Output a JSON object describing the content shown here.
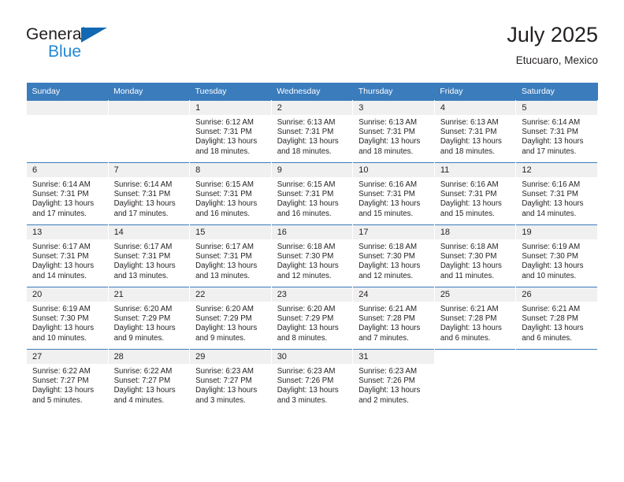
{
  "brand": {
    "name_top": "General",
    "name_bottom": "Blue",
    "triangle_color": "#1268b3",
    "blue_color": "#2389d4"
  },
  "header": {
    "title": "July 2025",
    "subtitle": "Etucuaro, Mexico"
  },
  "theme": {
    "header_bg": "#3b7cbd",
    "header_text": "#ffffff",
    "daynum_bg": "#f0f0f0",
    "daynum_bg_shaded": "#e8e8e8",
    "text": "#231f20"
  },
  "calendar": {
    "weekday_headers": [
      "Sunday",
      "Monday",
      "Tuesday",
      "Wednesday",
      "Thursday",
      "Friday",
      "Saturday"
    ],
    "labels": {
      "sunrise": "Sunrise:",
      "sunset": "Sunset:",
      "daylight": "Daylight:"
    },
    "weeks": [
      [
        {
          "day": "",
          "empty": true
        },
        {
          "day": "",
          "empty": true
        },
        {
          "day": "1",
          "sunrise": "Sunrise: 6:12 AM",
          "sunset": "Sunset: 7:31 PM",
          "daylight1": "Daylight: 13 hours",
          "daylight2": "and 18 minutes."
        },
        {
          "day": "2",
          "sunrise": "Sunrise: 6:13 AM",
          "sunset": "Sunset: 7:31 PM",
          "daylight1": "Daylight: 13 hours",
          "daylight2": "and 18 minutes."
        },
        {
          "day": "3",
          "sunrise": "Sunrise: 6:13 AM",
          "sunset": "Sunset: 7:31 PM",
          "daylight1": "Daylight: 13 hours",
          "daylight2": "and 18 minutes."
        },
        {
          "day": "4",
          "sunrise": "Sunrise: 6:13 AM",
          "sunset": "Sunset: 7:31 PM",
          "daylight1": "Daylight: 13 hours",
          "daylight2": "and 18 minutes."
        },
        {
          "day": "5",
          "sunrise": "Sunrise: 6:14 AM",
          "sunset": "Sunset: 7:31 PM",
          "daylight1": "Daylight: 13 hours",
          "daylight2": "and 17 minutes."
        }
      ],
      [
        {
          "day": "6",
          "sunrise": "Sunrise: 6:14 AM",
          "sunset": "Sunset: 7:31 PM",
          "daylight1": "Daylight: 13 hours",
          "daylight2": "and 17 minutes."
        },
        {
          "day": "7",
          "sunrise": "Sunrise: 6:14 AM",
          "sunset": "Sunset: 7:31 PM",
          "daylight1": "Daylight: 13 hours",
          "daylight2": "and 17 minutes."
        },
        {
          "day": "8",
          "sunrise": "Sunrise: 6:15 AM",
          "sunset": "Sunset: 7:31 PM",
          "daylight1": "Daylight: 13 hours",
          "daylight2": "and 16 minutes."
        },
        {
          "day": "9",
          "sunrise": "Sunrise: 6:15 AM",
          "sunset": "Sunset: 7:31 PM",
          "daylight1": "Daylight: 13 hours",
          "daylight2": "and 16 minutes."
        },
        {
          "day": "10",
          "sunrise": "Sunrise: 6:16 AM",
          "sunset": "Sunset: 7:31 PM",
          "daylight1": "Daylight: 13 hours",
          "daylight2": "and 15 minutes."
        },
        {
          "day": "11",
          "sunrise": "Sunrise: 6:16 AM",
          "sunset": "Sunset: 7:31 PM",
          "daylight1": "Daylight: 13 hours",
          "daylight2": "and 15 minutes."
        },
        {
          "day": "12",
          "sunrise": "Sunrise: 6:16 AM",
          "sunset": "Sunset: 7:31 PM",
          "daylight1": "Daylight: 13 hours",
          "daylight2": "and 14 minutes."
        }
      ],
      [
        {
          "day": "13",
          "sunrise": "Sunrise: 6:17 AM",
          "sunset": "Sunset: 7:31 PM",
          "daylight1": "Daylight: 13 hours",
          "daylight2": "and 14 minutes."
        },
        {
          "day": "14",
          "sunrise": "Sunrise: 6:17 AM",
          "sunset": "Sunset: 7:31 PM",
          "daylight1": "Daylight: 13 hours",
          "daylight2": "and 13 minutes."
        },
        {
          "day": "15",
          "sunrise": "Sunrise: 6:17 AM",
          "sunset": "Sunset: 7:31 PM",
          "daylight1": "Daylight: 13 hours",
          "daylight2": "and 13 minutes."
        },
        {
          "day": "16",
          "sunrise": "Sunrise: 6:18 AM",
          "sunset": "Sunset: 7:30 PM",
          "daylight1": "Daylight: 13 hours",
          "daylight2": "and 12 minutes."
        },
        {
          "day": "17",
          "sunrise": "Sunrise: 6:18 AM",
          "sunset": "Sunset: 7:30 PM",
          "daylight1": "Daylight: 13 hours",
          "daylight2": "and 12 minutes."
        },
        {
          "day": "18",
          "sunrise": "Sunrise: 6:18 AM",
          "sunset": "Sunset: 7:30 PM",
          "daylight1": "Daylight: 13 hours",
          "daylight2": "and 11 minutes."
        },
        {
          "day": "19",
          "sunrise": "Sunrise: 6:19 AM",
          "sunset": "Sunset: 7:30 PM",
          "daylight1": "Daylight: 13 hours",
          "daylight2": "and 10 minutes."
        }
      ],
      [
        {
          "day": "20",
          "sunrise": "Sunrise: 6:19 AM",
          "sunset": "Sunset: 7:30 PM",
          "daylight1": "Daylight: 13 hours",
          "daylight2": "and 10 minutes."
        },
        {
          "day": "21",
          "sunrise": "Sunrise: 6:20 AM",
          "sunset": "Sunset: 7:29 PM",
          "daylight1": "Daylight: 13 hours",
          "daylight2": "and 9 minutes."
        },
        {
          "day": "22",
          "sunrise": "Sunrise: 6:20 AM",
          "sunset": "Sunset: 7:29 PM",
          "daylight1": "Daylight: 13 hours",
          "daylight2": "and 9 minutes."
        },
        {
          "day": "23",
          "sunrise": "Sunrise: 6:20 AM",
          "sunset": "Sunset: 7:29 PM",
          "daylight1": "Daylight: 13 hours",
          "daylight2": "and 8 minutes."
        },
        {
          "day": "24",
          "sunrise": "Sunrise: 6:21 AM",
          "sunset": "Sunset: 7:28 PM",
          "daylight1": "Daylight: 13 hours",
          "daylight2": "and 7 minutes."
        },
        {
          "day": "25",
          "sunrise": "Sunrise: 6:21 AM",
          "sunset": "Sunset: 7:28 PM",
          "daylight1": "Daylight: 13 hours",
          "daylight2": "and 6 minutes."
        },
        {
          "day": "26",
          "sunrise": "Sunrise: 6:21 AM",
          "sunset": "Sunset: 7:28 PM",
          "daylight1": "Daylight: 13 hours",
          "daylight2": "and 6 minutes."
        }
      ],
      [
        {
          "day": "27",
          "sunrise": "Sunrise: 6:22 AM",
          "sunset": "Sunset: 7:27 PM",
          "daylight1": "Daylight: 13 hours",
          "daylight2": "and 5 minutes."
        },
        {
          "day": "28",
          "sunrise": "Sunrise: 6:22 AM",
          "sunset": "Sunset: 7:27 PM",
          "daylight1": "Daylight: 13 hours",
          "daylight2": "and 4 minutes."
        },
        {
          "day": "29",
          "sunrise": "Sunrise: 6:23 AM",
          "sunset": "Sunset: 7:27 PM",
          "daylight1": "Daylight: 13 hours",
          "daylight2": "and 3 minutes."
        },
        {
          "day": "30",
          "sunrise": "Sunrise: 6:23 AM",
          "sunset": "Sunset: 7:26 PM",
          "daylight1": "Daylight: 13 hours",
          "daylight2": "and 3 minutes."
        },
        {
          "day": "31",
          "sunrise": "Sunrise: 6:23 AM",
          "sunset": "Sunset: 7:26 PM",
          "daylight1": "Daylight: 13 hours",
          "daylight2": "and 2 minutes."
        },
        {
          "day": "",
          "blank": true
        },
        {
          "day": "",
          "blank": true
        }
      ]
    ]
  }
}
